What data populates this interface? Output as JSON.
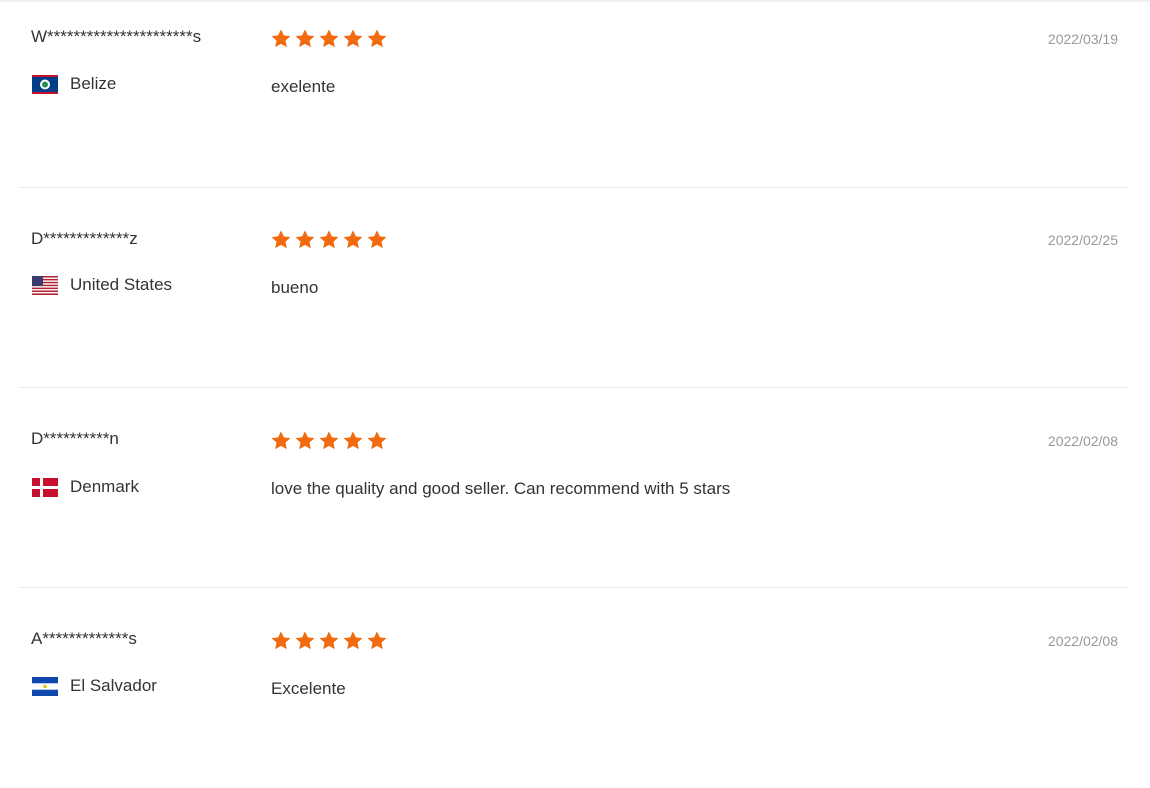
{
  "reviews": [
    {
      "user": "W**********************s",
      "country": "Belize",
      "flag_icon": "belize-flag-icon",
      "rating": 5,
      "date": "2022/03/19",
      "comment": "exelente"
    },
    {
      "user": "D*************z",
      "country": "United States",
      "flag_icon": "usa-flag-icon",
      "rating": 5,
      "date": "2022/02/25",
      "comment": "bueno"
    },
    {
      "user": "D**********n",
      "country": "Denmark",
      "flag_icon": "denmark-flag-icon",
      "rating": 5,
      "date": "2022/02/08",
      "comment": "love the quality and good seller. Can recommend with 5 stars"
    },
    {
      "user": "A*************s",
      "country": "El Salvador",
      "flag_icon": "el-salvador-flag-icon",
      "rating": 5,
      "date": "2022/02/08",
      "comment": "Excelente"
    }
  ],
  "colors": {
    "star": "#f26a10",
    "date": "#999999",
    "text": "#333333",
    "divider": "#ececec"
  }
}
